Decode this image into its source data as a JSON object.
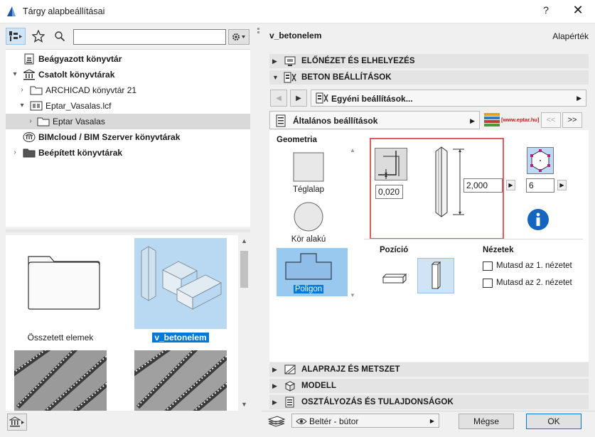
{
  "window": {
    "title": "Tárgy alapbeállításai",
    "help_label": "?",
    "close_label": "✕"
  },
  "left": {
    "search": {
      "value": "",
      "placeholder": ""
    },
    "tree": [
      {
        "label": "Beágyazott könyvtár",
        "bold": true,
        "arrow": ""
      },
      {
        "label": "Csatolt könyvtárak",
        "bold": true,
        "arrow": "▾"
      },
      {
        "label": "ARCHICAD könyvtár 21",
        "bold": false,
        "arrow": "›"
      },
      {
        "label": "Eptar_Vasalas.lcf",
        "bold": false,
        "arrow": "▾"
      },
      {
        "label": "Eptar Vasalas",
        "bold": false,
        "arrow": "›"
      },
      {
        "label": "BIMcloud / BIM Szerver könyvtárak",
        "bold": true,
        "arrow": ""
      },
      {
        "label": "Beépített könyvtárak",
        "bold": true,
        "arrow": "›"
      }
    ],
    "thumbs": [
      {
        "caption": "Összetett elemek"
      },
      {
        "caption": "v_betonelem"
      }
    ]
  },
  "right": {
    "object_name": "v_betonelem",
    "defaults_label": "Alapérték",
    "sections": {
      "preview": "ELŐNÉZET ÉS ELHELYEZÉS",
      "concrete": "BETON BEÁLLÍTÁSOK",
      "floorplan": "ALAPRAJZ ÉS METSZET",
      "model": "MODELL",
      "classification": "OSZTÁLYOZÁS ÉS TULAJDONSÁGOK"
    },
    "custom_settings": "Egyéni beállítások...",
    "general_settings": "Általános beállítások",
    "eptar_url": "[www.eptar.hu]",
    "prev_label": "<<",
    "next_label": ">>",
    "geometry": {
      "title": "Geometria",
      "items": [
        "Téglalap",
        "Kör alakú",
        "Poligon"
      ],
      "selected": "Poligon"
    },
    "params": {
      "offset": "0,020",
      "height": "2,000",
      "sides": "6"
    },
    "position_label": "Pozíció",
    "views_label": "Nézetek",
    "views": [
      "Mutasd az 1. nézetet",
      "Mutasd az 2. nézetet"
    ]
  },
  "footer": {
    "view_option": "Beltér - bútor",
    "cancel": "Mégse",
    "ok": "OK"
  },
  "colors": {
    "selection": "#0078d7",
    "highlight_frame": "#e05b5b",
    "info_blue": "#1565c0"
  }
}
